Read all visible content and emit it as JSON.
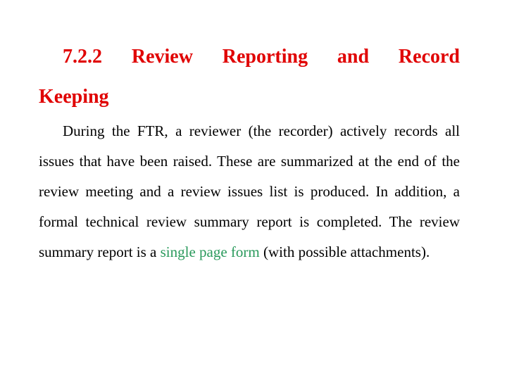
{
  "heading": {
    "number": "7.2.2",
    "title_line1": "7.2.2 Review Reporting and Record",
    "title_line2": "Keeping",
    "color": "#e00000"
  },
  "body": {
    "text_before_highlight": "During the FTR, a reviewer (the recorder) actively records all issues that have been raised. These are summarized at the end of the review meeting and a review issues list is produced. In addition, a formal technical review summary report is completed. The review summary report is a ",
    "highlight": "single page form",
    "text_after_highlight": " (with possible attachments).",
    "text_color": "#000000",
    "highlight_color": "#2a9a5c"
  }
}
